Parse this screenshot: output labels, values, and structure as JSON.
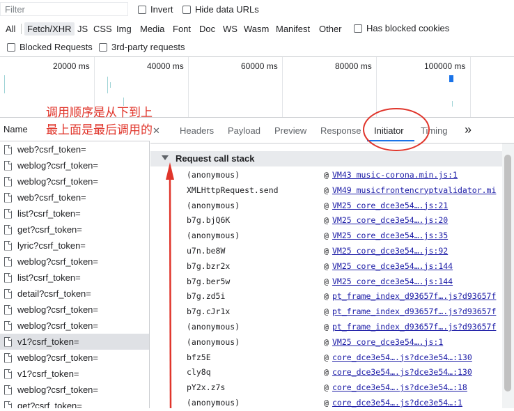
{
  "toolbar": {
    "filter_placeholder": "Filter",
    "invert_label": "Invert",
    "hide_data_urls_label": "Hide data URLs",
    "types": [
      "All",
      "Fetch/XHR",
      "JS",
      "CSS",
      "Img",
      "Media",
      "Font",
      "Doc",
      "WS",
      "Wasm",
      "Manifest",
      "Other"
    ],
    "active_type": "Fetch/XHR",
    "has_blocked_cookies_label": "Has blocked cookies",
    "blocked_requests_label": "Blocked Requests",
    "third_party_label": "3rd-party requests"
  },
  "timeline": {
    "ticks": [
      "20000 ms",
      "40000 ms",
      "60000 ms",
      "80000 ms",
      "100000 ms"
    ],
    "bar_color": "#1a73e8"
  },
  "requests": {
    "column_name": "Name",
    "items": [
      "web?csrf_token=",
      "weblog?csrf_token=",
      "weblog?csrf_token=",
      "web?csrf_token=",
      "list?csrf_token=",
      "get?csrf_token=",
      "lyric?csrf_token=",
      "weblog?csrf_token=",
      "list?csrf_token=",
      "detail?csrf_token=",
      "weblog?csrf_token=",
      "weblog?csrf_token=",
      "v1?csrf_token=",
      "weblog?csrf_token=",
      "v1?csrf_token=",
      "weblog?csrf_token=",
      "get?csrf_token="
    ],
    "selected_index": 12
  },
  "tabs": {
    "headers": "Headers",
    "payload": "Payload",
    "preview": "Preview",
    "response": "Response",
    "initiator": "Initiator",
    "timing": "Timing",
    "more": "»",
    "active": "Initiator"
  },
  "callstack": {
    "title": "Request call stack",
    "frames": [
      {
        "fn": "(anonymous)",
        "loc": "VM43 music-corona.min.js:1"
      },
      {
        "fn": "XMLHttpRequest.send",
        "loc": "VM49 musicfrontencryptvalidator.mi"
      },
      {
        "fn": "(anonymous)",
        "loc": "VM25 core_dce3e54….js:21"
      },
      {
        "fn": "b7g.bjQ6K",
        "loc": "VM25 core_dce3e54….js:20"
      },
      {
        "fn": "(anonymous)",
        "loc": "VM25 core_dce3e54….js:35"
      },
      {
        "fn": "u7n.be8W",
        "loc": "VM25 core_dce3e54….js:92"
      },
      {
        "fn": "b7g.bzr2x",
        "loc": "VM25 core_dce3e54….js:144"
      },
      {
        "fn": "b7g.ber5w",
        "loc": "VM25 core_dce3e54….js:144"
      },
      {
        "fn": "b7g.zd5i",
        "loc": "pt_frame_index_d93657f….js?d93657f"
      },
      {
        "fn": "b7g.cJr1x",
        "loc": "pt_frame_index_d93657f….js?d93657f"
      },
      {
        "fn": "(anonymous)",
        "loc": "pt_frame_index_d93657f….js?d93657f"
      },
      {
        "fn": "(anonymous)",
        "loc": "VM25 core_dce3e54….js:1"
      },
      {
        "fn": "bfz5E",
        "loc": "core_dce3e54….js?dce3e54…:130"
      },
      {
        "fn": "cly8q",
        "loc": "core_dce3e54….js?dce3e54…:130"
      },
      {
        "fn": "pY2x.z7s",
        "loc": "core_dce3e54….js?dce3e54…:18"
      },
      {
        "fn": "(anonymous)",
        "loc": "core_dce3e54….js?dce3e54…:1"
      }
    ]
  },
  "annotation": {
    "line1": "调用顺序是从下到上",
    "line2": "最上面是最后调用的",
    "color": "#e0352b"
  }
}
